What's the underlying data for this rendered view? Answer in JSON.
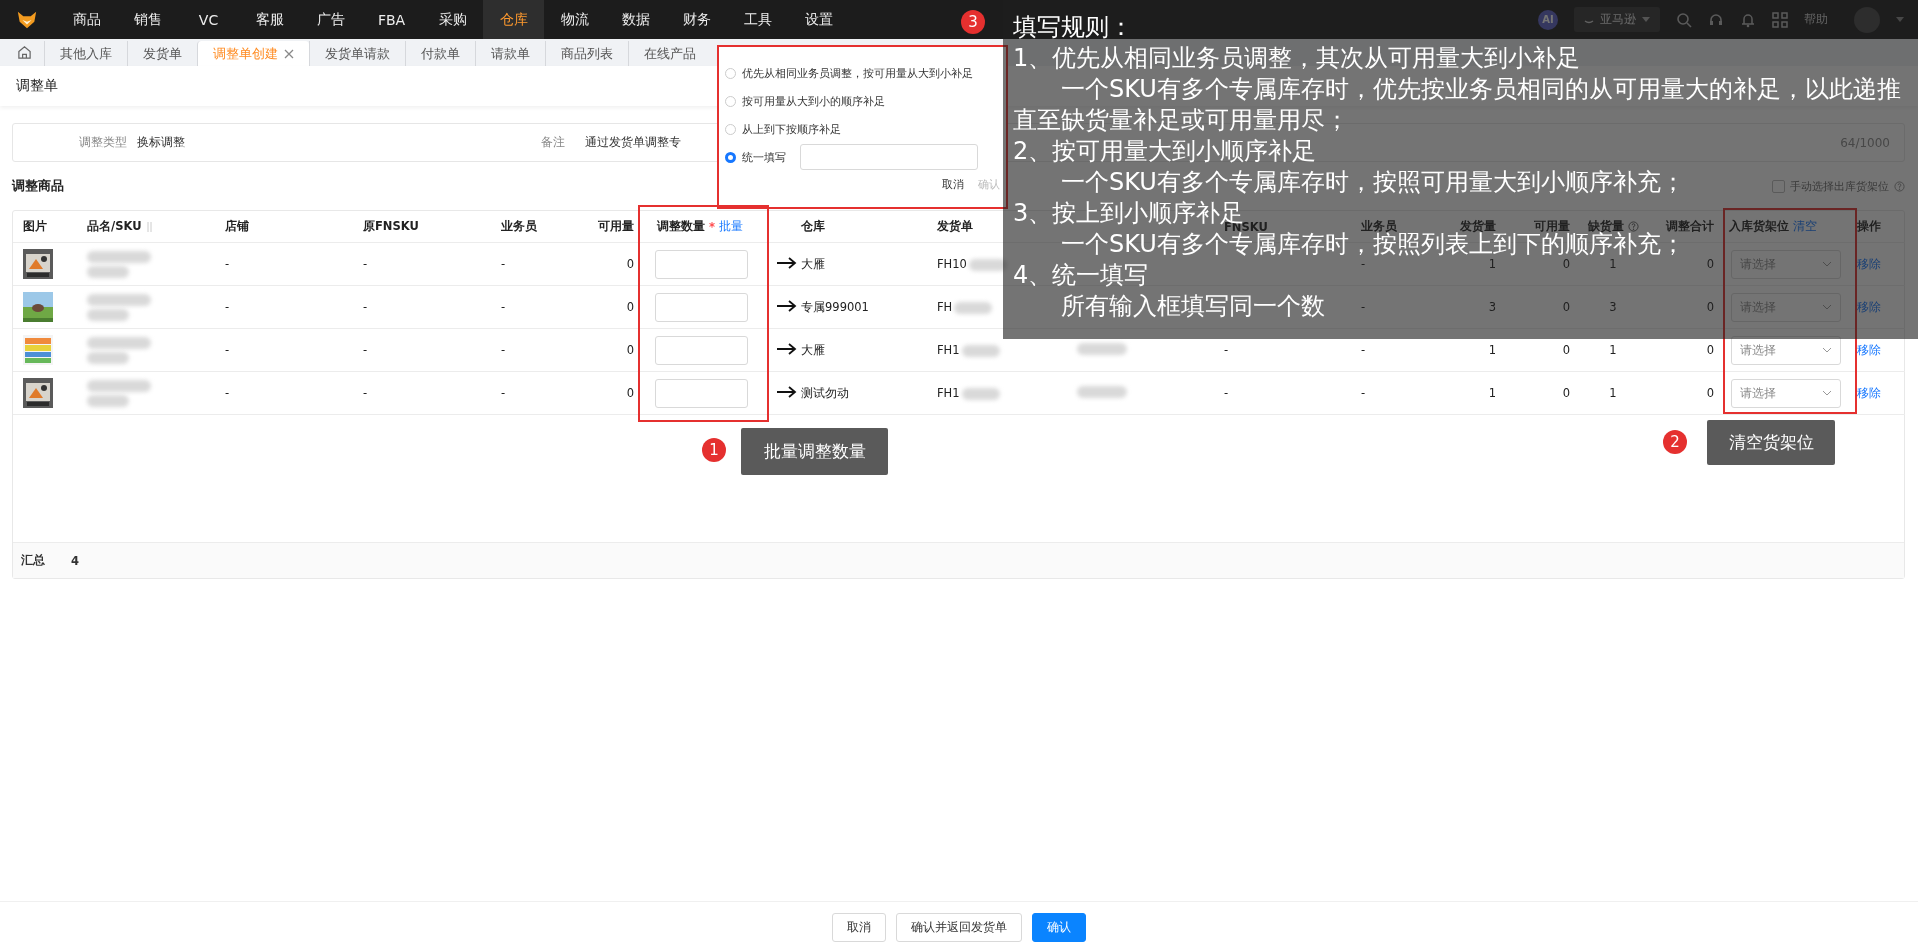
{
  "nav": {
    "items": [
      {
        "label": "商品",
        "selected": false
      },
      {
        "label": "销售",
        "selected": false
      },
      {
        "label": "VC",
        "selected": false
      },
      {
        "label": "客服",
        "selected": false
      },
      {
        "label": "广告",
        "selected": false
      },
      {
        "label": "FBA",
        "selected": false
      },
      {
        "label": "采购",
        "selected": false
      },
      {
        "label": "仓库",
        "selected": true
      },
      {
        "label": "物流",
        "selected": false
      },
      {
        "label": "数据",
        "selected": false
      },
      {
        "label": "财务",
        "selected": false
      },
      {
        "label": "工具",
        "selected": false
      },
      {
        "label": "设置",
        "selected": false
      }
    ],
    "ai": "AI",
    "platform": "亚马逊",
    "help": "帮助"
  },
  "tabs": [
    {
      "label": "其他入库",
      "selected": false
    },
    {
      "label": "发货单",
      "selected": false
    },
    {
      "label": "调整单创建",
      "selected": true
    },
    {
      "label": "发货单请款",
      "selected": false
    },
    {
      "label": "付款单",
      "selected": false
    },
    {
      "label": "请款单",
      "selected": false
    },
    {
      "label": "商品列表",
      "selected": false
    },
    {
      "label": "在线产品",
      "selected": false
    }
  ],
  "page_title": "调整单",
  "form": {
    "type_label": "调整类型",
    "type_value": "换标调整",
    "remark_label": "备注",
    "remark_value": "通过发货单调整专",
    "counter": "64/1000"
  },
  "section_title": "调整商品",
  "manual_shelf": {
    "label": "手动选择出库货架位",
    "checked": false
  },
  "table": {
    "columns": [
      {
        "label": "图片",
        "kind": "plain"
      },
      {
        "label": "品名/SKU",
        "kind": "sort"
      },
      {
        "label": "店铺",
        "kind": "plain"
      },
      {
        "label": "原FNSKU",
        "kind": "plain"
      },
      {
        "label": "业务员",
        "kind": "plain"
      },
      {
        "label": "可用量",
        "kind": "plain"
      },
      {
        "label": "调整数量",
        "kind": "batch",
        "mark": "*",
        "link": "批量"
      },
      {
        "label": "仓库",
        "kind": "plain"
      },
      {
        "label": "发货单",
        "kind": "plain"
      },
      {
        "label": "FNSKU",
        "kind": "plain"
      },
      {
        "label": "业务员",
        "kind": "plain"
      },
      {
        "label": "发货量",
        "kind": "plain"
      },
      {
        "label": "可用量",
        "kind": "plain"
      },
      {
        "label": "缺货量",
        "kind": "help"
      },
      {
        "label": "调整合计",
        "kind": "plain"
      },
      {
        "label": "入库货架位",
        "kind": "clear",
        "link": "清空"
      },
      {
        "label": "操作",
        "kind": "plain"
      }
    ],
    "rows": [
      {
        "store": "-",
        "orig_fnsku": "-",
        "salesman": "-",
        "available": "0",
        "warehouse": "大雁",
        "shipment": "FH10",
        "salesman2": "-",
        "shipped": "1",
        "available2": "0",
        "shortage": "1",
        "total": "0",
        "shelf_placeholder": "请选择",
        "action": "移除"
      },
      {
        "store": "-",
        "orig_fnsku": "-",
        "salesman": "-",
        "available": "0",
        "warehouse": "专属999001",
        "shipment": "FH",
        "salesman2": "-",
        "shipped": "3",
        "available2": "0",
        "shortage": "3",
        "total": "0",
        "shelf_placeholder": "请选择",
        "action": "移除"
      },
      {
        "store": "-",
        "orig_fnsku": "-",
        "salesman": "-",
        "available": "0",
        "warehouse": "大雁",
        "shipment": "FH1",
        "fnsku": "-",
        "salesman2": "-",
        "shipped": "1",
        "available2": "0",
        "shortage": "1",
        "total": "0",
        "shelf_placeholder": "请选择",
        "action": "移除"
      },
      {
        "store": "-",
        "orig_fnsku": "-",
        "salesman": "-",
        "available": "0",
        "warehouse": "测试勿动",
        "shipment": "FH1",
        "fnsku": "-",
        "salesman2": "-",
        "shipped": "1",
        "available2": "0",
        "shortage": "1",
        "total": "0",
        "shelf_placeholder": "请选择",
        "action": "移除"
      }
    ],
    "summary_label": "汇总",
    "summary_value": "4"
  },
  "batch_popup": {
    "options": [
      {
        "label": "优先从相同业务员调整，按可用量从大到小补足",
        "selected": false,
        "kind": "radio"
      },
      {
        "label": "按可用量从大到小的顺序补足",
        "selected": false,
        "kind": "radio"
      },
      {
        "label": "从上到下按顺序补足",
        "selected": false,
        "kind": "radio"
      },
      {
        "label": "统一填写",
        "selected": true,
        "kind": "input"
      }
    ],
    "cancel": "取消",
    "confirm": "确认",
    "confirm_disabled": true
  },
  "rules": {
    "badge": "3",
    "title": "填写规则：",
    "lines": [
      {
        "kind": "heading",
        "text": "1、优先从相同业务员调整，其次从可用量大到小补足"
      },
      {
        "kind": "detail",
        "text": "一个SKU有多个专属库存时，优先按业务员相同的从可用量大的补足，以此递推直至缺货量补足或可用量用尽；"
      },
      {
        "kind": "heading",
        "text": "2、按可用量大到小顺序补足"
      },
      {
        "kind": "detail",
        "text": "一个SKU有多个专属库存时，按照可用量大到小顺序补充；"
      },
      {
        "kind": "heading",
        "text": "3、按上到小顺序补足"
      },
      {
        "kind": "detail",
        "text": "一个SKU有多个专属库存时，按照列表上到下的顺序补充；"
      },
      {
        "kind": "heading",
        "text": "4、统一填写"
      },
      {
        "kind": "detail",
        "text": "所有输入框填写同一个数"
      }
    ]
  },
  "callouts": [
    {
      "badge": "1",
      "text": "批量调整数量"
    },
    {
      "badge": "2",
      "text": "清空货架位"
    }
  ],
  "footer": {
    "buttons": [
      {
        "label": "取消",
        "kind": "default"
      },
      {
        "label": "确认并返回发货单",
        "kind": "default"
      },
      {
        "label": "确认",
        "kind": "primary"
      }
    ]
  }
}
